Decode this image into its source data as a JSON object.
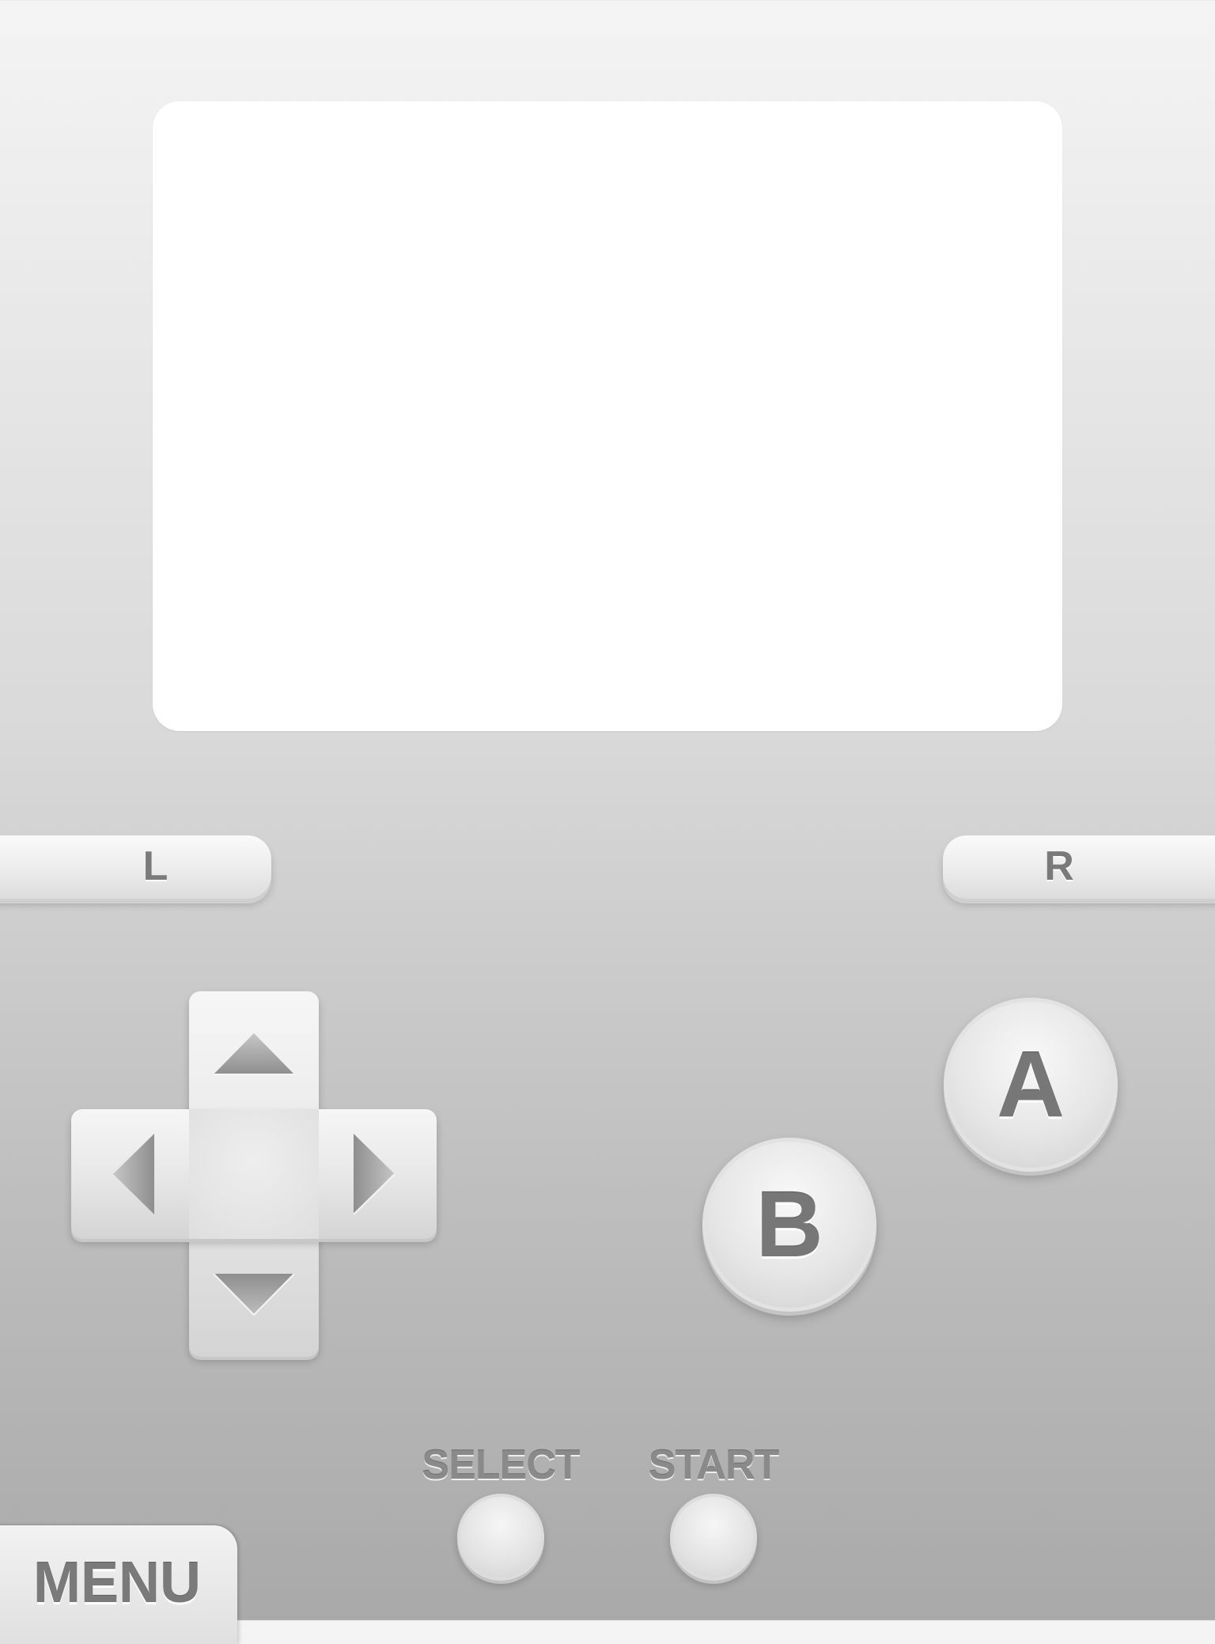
{
  "emulator": {
    "screen": {
      "content": ""
    },
    "buttons": {
      "l_label": "L",
      "r_label": "R",
      "a_label": "A",
      "b_label": "B",
      "select_label": "SELECT",
      "start_label": "START",
      "menu_label": "MENU"
    },
    "dpad": {
      "directions": [
        "up",
        "down",
        "left",
        "right"
      ]
    },
    "colors": {
      "background_top": "#f4f4f4",
      "background_bottom": "#a9a9a9",
      "screen": "#ffffff",
      "button_face": "#e6e6e6",
      "label_text": "#7a7a7a"
    }
  }
}
